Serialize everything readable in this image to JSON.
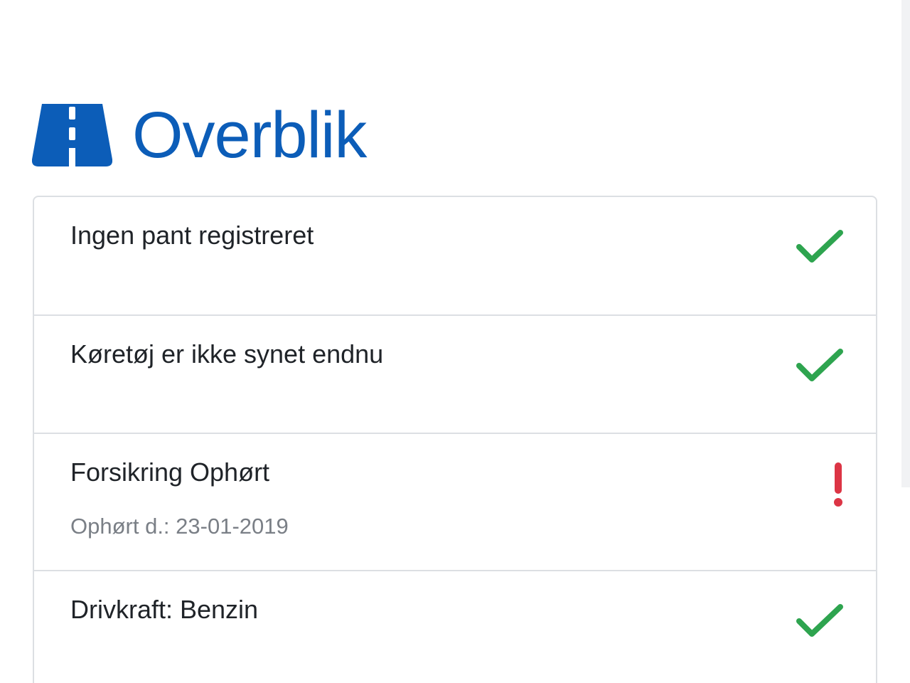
{
  "header": {
    "icon": "road-icon",
    "title": "Overblik",
    "accent_color": "#0c5db8"
  },
  "overview": {
    "items": [
      {
        "label": "Ingen pant registreret",
        "status": "ok",
        "icon": "check-icon"
      },
      {
        "label": "Køretøj er ikke synet endnu",
        "status": "ok",
        "icon": "check-icon"
      },
      {
        "label": "Forsikring Ophørt",
        "detail": "Ophørt d.: 23-01-2019",
        "status": "warning",
        "icon": "exclamation-icon"
      },
      {
        "label": "Drivkraft: Benzin",
        "status": "ok",
        "icon": "check-icon"
      }
    ]
  },
  "colors": {
    "ok": "#2ea44f",
    "warning": "#dc3545",
    "border": "#dcdfe3"
  }
}
